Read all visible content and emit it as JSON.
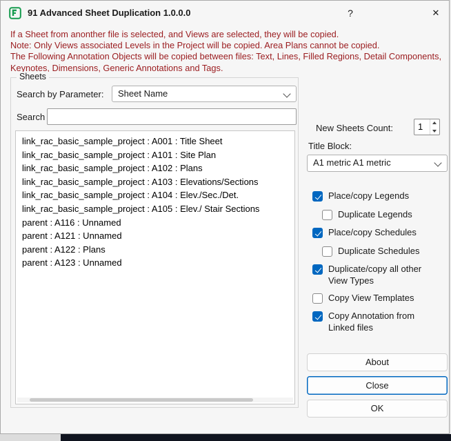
{
  "window": {
    "title": "91 Advanced Sheet Duplication 1.0.0.0",
    "help_label": "?",
    "close_label": "✕"
  },
  "warnings": {
    "line1": "If a Sheet from anonther file is selected, and Views are selected, they will be copied.",
    "line2": "Note: Only Views associated Levels in the Project will be copied. Area Plans cannot be copied.",
    "line3": "The Following Annotation Objects will be copied between files: Text, Lines, Filled Regions, Detail Components, Keynotes, Dimensions, Generic Annotations and Tags."
  },
  "sheets": {
    "group_label": "Sheets",
    "search_by_parameter_label": "Search by Parameter:",
    "parameter_value": "Sheet Name",
    "search_label": "Search",
    "search_value": "",
    "items": [
      "link_rac_basic_sample_project : A001 : Title Sheet",
      "link_rac_basic_sample_project : A101 : Site Plan",
      "link_rac_basic_sample_project : A102 : Plans",
      "link_rac_basic_sample_project : A103 : Elevations/Sections",
      "link_rac_basic_sample_project : A104 : Elev./Sec./Det.",
      "link_rac_basic_sample_project : A105 : Elev./ Stair Sections",
      "parent : A116 : Unnamed",
      "parent : A121 : Unnamed",
      "parent : A122 : Plans",
      "parent : A123 : Unnamed"
    ]
  },
  "right": {
    "new_sheets_count_label": "New Sheets Count:",
    "new_sheets_count_value": "1",
    "title_block_label": "Title Block:",
    "title_block_value": "A1 metric A1 metric",
    "checkboxes": [
      {
        "label": "Place/copy Legends",
        "checked": true
      },
      {
        "label": "Duplicate Legends",
        "checked": false
      },
      {
        "label": "Place/copy Schedules",
        "checked": true
      },
      {
        "label": "Duplicate Schedules",
        "checked": false
      },
      {
        "label": "Duplicate/copy all other View Types",
        "checked": true
      },
      {
        "label": "Copy View Templates",
        "checked": false
      },
      {
        "label": "Copy Annotation from Linked files",
        "checked": true
      }
    ],
    "about_label": "About",
    "close_label": "Close",
    "ok_label": "OK"
  },
  "colors": {
    "accent": "#0067c0",
    "warning_text": "#9a1b1e",
    "icon_green": "#169b4e"
  }
}
